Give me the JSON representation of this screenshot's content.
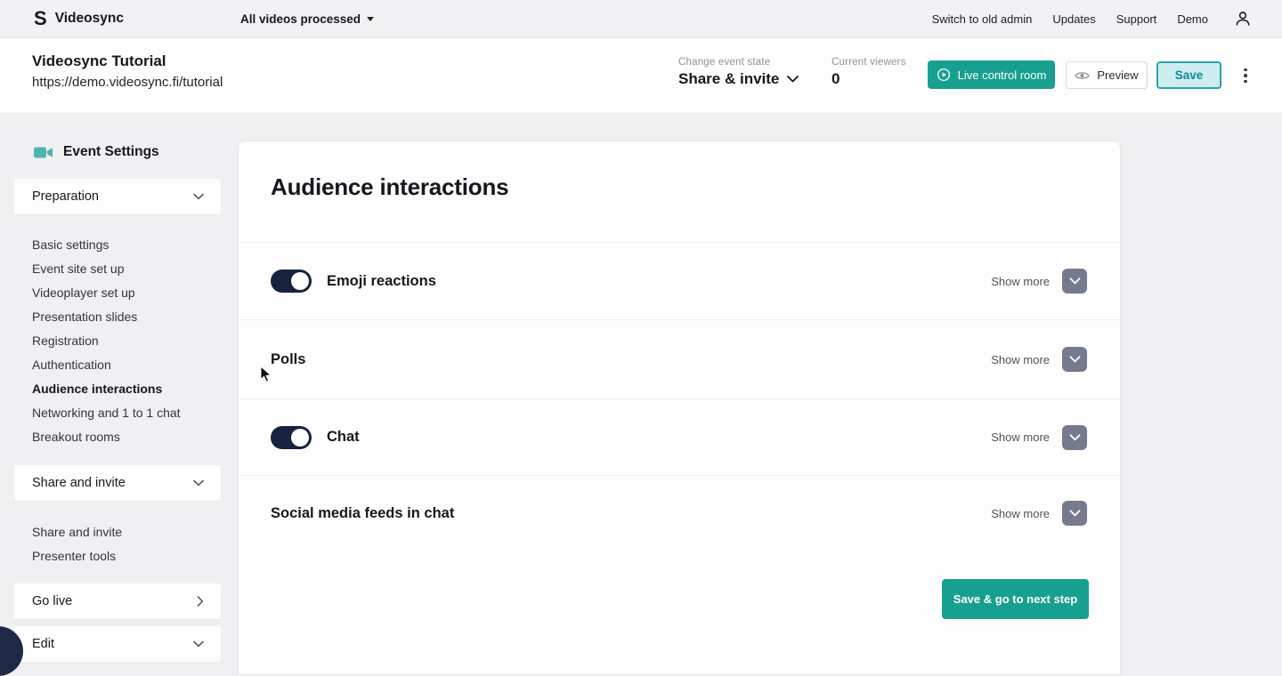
{
  "topbar": {
    "brand": "Videosync",
    "processed_dropdown": "All videos processed",
    "links": [
      "Switch to old admin",
      "Updates",
      "Support",
      "Demo"
    ]
  },
  "header": {
    "event_title": "Videosync Tutorial",
    "event_url": "https://demo.videosync.fi/tutorial",
    "state_label": "Change event state",
    "state_value": "Share & invite",
    "viewers_label": "Current viewers",
    "viewers_value": "0",
    "live_button": "Live control room",
    "preview_button": "Preview",
    "save_button": "Save"
  },
  "sidebar": {
    "title": "Event Settings",
    "preparation_label": "Preparation",
    "prep_items": [
      "Basic settings",
      "Event site set up",
      "Videoplayer set up",
      "Presentation slides",
      "Registration",
      "Authentication",
      "Audience interactions",
      "Networking and 1 to 1 chat",
      "Breakout rooms"
    ],
    "active_item": "Audience interactions",
    "share_section_label": "Share and invite",
    "share_items": [
      "Share and invite",
      "Presenter tools"
    ],
    "golive_label": "Go live",
    "edit_label": "Edit"
  },
  "main": {
    "title": "Audience interactions",
    "rows": [
      {
        "label": "Emoji reactions",
        "show_more": "Show more",
        "toggle": "on"
      },
      {
        "label": "Polls",
        "show_more": "Show more",
        "toggle": "none"
      },
      {
        "label": "Chat",
        "show_more": "Show more",
        "toggle": "on"
      },
      {
        "label": "Social media feeds in chat",
        "show_more": "Show more",
        "toggle": "none"
      }
    ],
    "save_next_button": "Save & go to next step"
  },
  "colors": {
    "teal": "#17a08f",
    "navy": "#16233f",
    "save_bg": "#cdeef0",
    "save_border": "#28a4ac",
    "page_bg": "#f0eff1"
  }
}
